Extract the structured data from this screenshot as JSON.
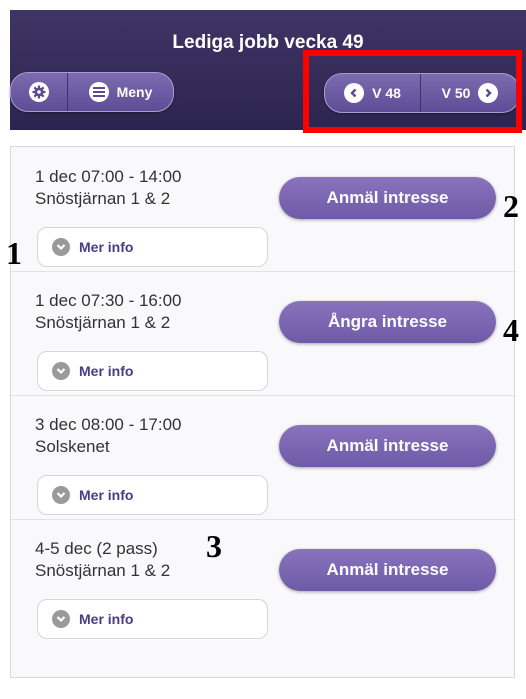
{
  "header": {
    "title": "Lediga jobb vecka 49",
    "menu_label": "Meny",
    "prev_week": "V 48",
    "next_week": "V 50"
  },
  "icons": {
    "settings": "gear-icon",
    "menu": "bars-icon",
    "prev": "chevron-left-icon",
    "next": "chevron-right-icon",
    "more": "chevron-down-icon"
  },
  "jobs": [
    {
      "time": "1 dec 07:00 - 14:00",
      "place": "Snöstjärnan 1 & 2",
      "more": "Mer info",
      "action": "Anmäl intresse"
    },
    {
      "time": "1 dec 07:30 - 16:00",
      "place": "Snöstjärnan 1 & 2",
      "more": "Mer info",
      "action": "Ångra intresse"
    },
    {
      "time": "3 dec 08:00 - 17:00",
      "place": "Solskenet",
      "more": "Mer info",
      "action": "Anmäl intresse"
    },
    {
      "time": "4-5 dec (2 pass)",
      "place": "Snöstjärnan 1 & 2",
      "more": "Mer info",
      "action": "Anmäl intresse"
    }
  ],
  "annotations": [
    "1",
    "2",
    "3",
    "4"
  ],
  "colors": {
    "header": "#2f2755",
    "button": "#6e5aa7",
    "highlight": "#ff0000"
  }
}
